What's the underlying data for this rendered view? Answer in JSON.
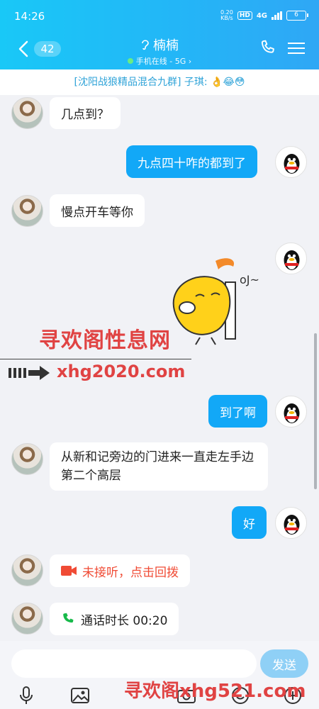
{
  "status": {
    "time": "14:26",
    "speed_value": "0.20",
    "speed_unit": "KB/s",
    "hd": "HD",
    "network": "4G",
    "battery": "6"
  },
  "header": {
    "unread_count": "42",
    "title": "楠楠",
    "subtitle": "手机在线 - 5G ›"
  },
  "notice": {
    "text": "[沈阳战狼精品混合九群] 子琪: 👌😂😳"
  },
  "messages": [
    {
      "side": "left",
      "text": "几点到？"
    },
    {
      "side": "right",
      "text": "九点四十咋的都到了"
    },
    {
      "side": "left",
      "text": "慢点开车等你"
    },
    {
      "side": "right",
      "type": "sticker",
      "sticker_text": "oJ~"
    },
    {
      "side": "right",
      "text": "到了啊"
    },
    {
      "side": "left",
      "text": "从新和记旁边的门进来一直走左手边第二个高层"
    },
    {
      "side": "right",
      "text": "好"
    },
    {
      "side": "left",
      "type": "call",
      "text": "未接听，点击回拨",
      "color": "#f04b35"
    },
    {
      "side": "left",
      "type": "call",
      "text": "通话时长 00:20",
      "color": "#17b94a"
    }
  ],
  "watermarks": {
    "top": "寻欢阁性息网",
    "middle": "xhg2020.com",
    "bottom": "寻欢阁xhg521.com"
  },
  "input": {
    "placeholder": "",
    "send_label": "发送"
  },
  "toolbar_icons": [
    "microphone-icon",
    "image-icon",
    "camera-icon",
    "emoji-icon",
    "plus-icon"
  ],
  "colors": {
    "header_start": "#19c8f7",
    "header_end": "#2fa7f5",
    "my_bubble": "#12a8f7",
    "send_button": "#8fd0f6"
  }
}
